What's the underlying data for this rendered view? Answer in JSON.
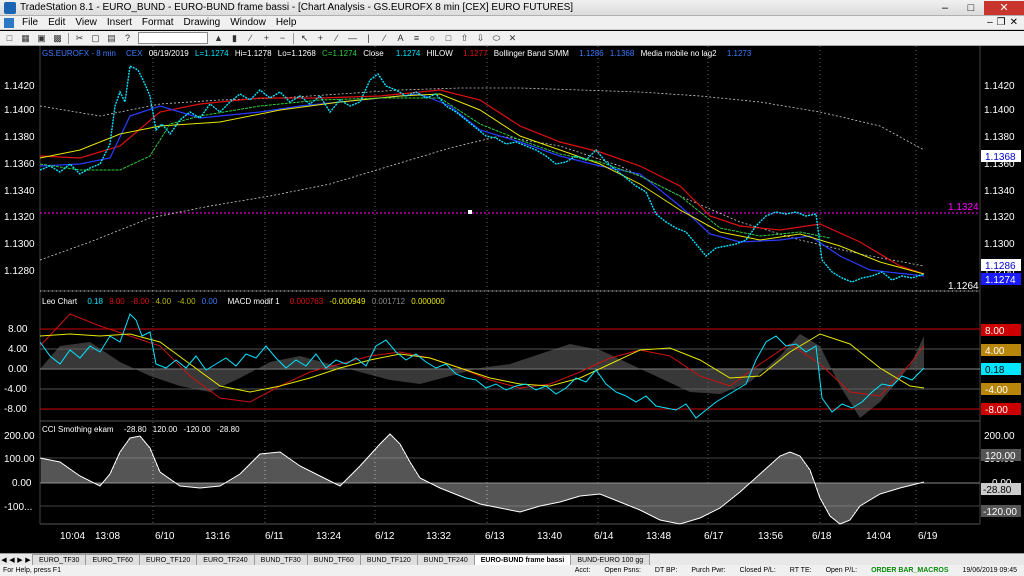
{
  "window": {
    "title": "TradeStation 8.1 - EURO_BUND - EURO-BUND frame bassi - [Chart Analysis - GS.EUROFX  8 min  [CEX] EURO FUTURES]"
  },
  "menu": {
    "items": [
      "File",
      "Edit",
      "View",
      "Insert",
      "Format",
      "Drawing",
      "Window",
      "Help"
    ]
  },
  "price_panel": {
    "symbol": "GS.EUROFX - 8 min",
    "exchange": "CEX",
    "date": "06/19/2019",
    "last": "L=1.1274",
    "hi": "Hi=1.1278",
    "lo": "Lo=1.1268",
    "close_val": "C=1.1274",
    "close_label": "Close",
    "close_num": "1.1274",
    "hilow_label": "HILOW",
    "hilow_val": "1.1277",
    "bb_label": "Bollinger Band S/MM",
    "bb_v1": "1.1286",
    "bb_v2": "1.1368",
    "mm_label": "Media mobile no lag2",
    "mm_val": "1.1273",
    "ref_level_label": "1.1324",
    "low_level_label": "1.1264",
    "y_ticks": [
      "1.1420",
      "1.1400",
      "1.1380",
      "1.1360",
      "1.1340",
      "1.1320",
      "1.1300",
      "1.1280"
    ],
    "y_ticks_right": [
      "1.1420",
      "1.1400",
      "1.1380",
      "1.1360",
      "1.1340",
      "1.1320",
      "1.1300",
      "1.1280"
    ],
    "badges": [
      {
        "text": "1.1368",
        "bg": "#ffffff",
        "fg": "#0000cc"
      },
      {
        "text": "1.1286",
        "bg": "#ffffff",
        "fg": "#0000cc"
      },
      {
        "text": "1.1274",
        "bg": "#1a1aff",
        "fg": "#ffffff"
      }
    ]
  },
  "macd_panel": {
    "name": "Leo Chart",
    "v1": "0.18",
    "v2": "8.00",
    "v3": "-8.00",
    "v4": "4.00",
    "v5": "-4.00",
    "v6": "0.00",
    "macd_label": "MACD modif 1",
    "m1": "0.000763",
    "m2": "-0.000949",
    "m3": "0.001712",
    "m4": "0.000000",
    "y_ticks": [
      "8.00",
      "4.00",
      "0.00",
      "-4.00",
      "-8.00"
    ],
    "badges": [
      {
        "text": "8.00",
        "bg": "#cc0000",
        "fg": "#ffffff"
      },
      {
        "text": "4.00",
        "bg": "#b8860b",
        "fg": "#ffffff"
      },
      {
        "text": "0.18",
        "bg": "#00e5ff",
        "fg": "#000000"
      },
      {
        "text": "-4.00",
        "bg": "#b8860b",
        "fg": "#ffffff"
      },
      {
        "text": "-8.00",
        "bg": "#cc0000",
        "fg": "#ffffff"
      }
    ]
  },
  "cci_panel": {
    "name": "CCI Smothing ekam",
    "v1": "-28.80",
    "v2": "120.00",
    "v3": "-120.00",
    "v4": "-28.80",
    "y_ticks": [
      "200.00",
      "100.00",
      "0.00",
      "-100..."
    ],
    "y_ticks_right": [
      "200.00",
      "100.00",
      "0.00"
    ],
    "badges": [
      {
        "text": "120.00",
        "bg": "#555555",
        "fg": "#ffffff"
      },
      {
        "text": "-28.80",
        "bg": "#cccccc",
        "fg": "#000000"
      },
      {
        "text": "-120.00",
        "bg": "#555555",
        "fg": "#ffffff"
      }
    ]
  },
  "x_axis": {
    "labels": [
      "10:04",
      "13:08",
      "6/10",
      "13:16",
      "6/11",
      "13:24",
      "6/12",
      "13:32",
      "6/13",
      "13:40",
      "6/14",
      "13:48",
      "6/17",
      "13:56",
      "6/18",
      "14:04",
      "6/19"
    ]
  },
  "colors": {
    "price": "#00e5ff",
    "bb_upper": "#cccccc",
    "red_ma": "#e01010",
    "blue_ma": "#2a3cff",
    "yellow_ma": "#e6e600",
    "green_ma": "#2ecc40",
    "magenta_level": "#ff00ff",
    "white_level": "#cccccc"
  },
  "tabs": {
    "items": [
      "EURO_TF30",
      "EURO_TF60",
      "EURO_TF120",
      "EURO_TF240",
      "BUND_TF30",
      "BUND_TF60",
      "BUND_TF120",
      "BUND_TF240",
      "EURO-BUND frame bassi",
      "BUND-EURO 100 gg"
    ],
    "active_index": 8
  },
  "status": {
    "help": "For Help, press F1",
    "acct": "Acct:",
    "open_psns": "Open Psns:",
    "dt_bp": "DT BP:",
    "purch_pwr": "Purch Pwr:",
    "closed_pl": "Closed P/L:",
    "rt_te": "RT TE:",
    "open_pl": "Open P/L:",
    "macros": "ORDER BAR_MACROS",
    "datetime": "19/06/2019 09:45"
  }
}
